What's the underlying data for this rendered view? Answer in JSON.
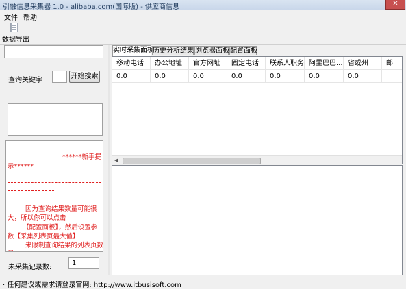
{
  "window": {
    "title": "引融信息采集器 1.0 - alibaba.com(国际版) - 供应商信息",
    "close_label": "✕"
  },
  "menu": {
    "items": [
      "文件",
      "帮助"
    ]
  },
  "toolbar": {
    "export_label": "数据导出",
    "export_icon": "document-icon"
  },
  "left": {
    "keyword_label": "查询关键字",
    "keyword_value": "",
    "search_button": "开始搜索",
    "tips": {
      "line1": "******新手提",
      "line2": "示******",
      "line3": "因为查询结果数量可能很",
      "line4": "大，所以你可以点击",
      "line5": "【配置面板】，然后设置参",
      "line6": "数【采集列表页最大值】",
      "line7": "来限制查询结果的列表页数",
      "line8": "量"
    },
    "uncollected_label": "未采集记录数:",
    "uncollected_value": "1"
  },
  "tabs": [
    "实时采集面板",
    "历史分析结果",
    "浏览器面板",
    "配置面板"
  ],
  "grid": {
    "columns": [
      "移动电话",
      "办公地址",
      "官方网址",
      "固定电话",
      "联系人职务",
      "阿里巴巴...",
      "省或州",
      "邮"
    ],
    "rows": [
      [
        "0.0",
        "0.0",
        "0.0",
        "0.0",
        "0.0",
        "0.0",
        "0.0",
        ""
      ]
    ]
  },
  "status": {
    "text": "· 任何建议或需求请登录官网:  http://www.itbusisoft.com"
  },
  "colors": {
    "tip_red": "#e02020",
    "close_red": "#c75050"
  }
}
